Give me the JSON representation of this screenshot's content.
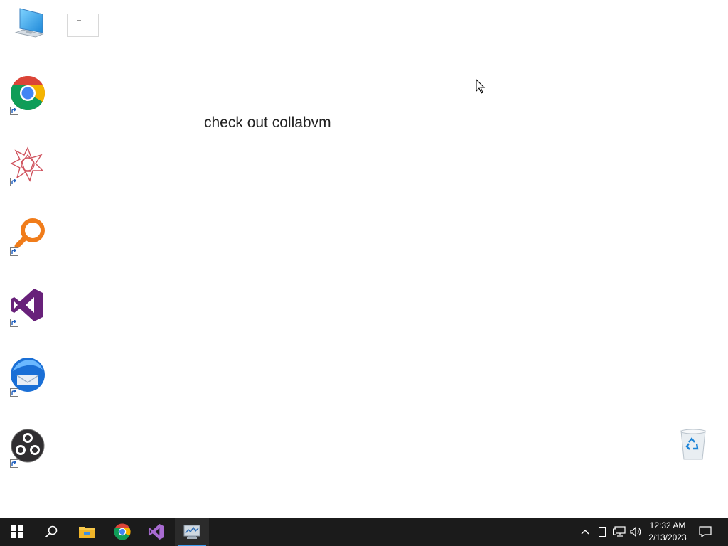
{
  "desktop": {
    "text": "check out collabvm",
    "icons": [
      {
        "name": "this-pc-icon"
      },
      {
        "name": "google-chrome-icon"
      },
      {
        "name": "wolfram-mathematica-icon"
      },
      {
        "name": "magnifier-search-app-icon"
      },
      {
        "name": "visual-studio-icon"
      },
      {
        "name": "thunderbird-icon"
      },
      {
        "name": "obs-studio-icon"
      },
      {
        "name": "recycle-bin-icon"
      }
    ]
  },
  "taskbar": {
    "buttons": [
      "start-icon",
      "search-icon",
      "file-explorer-icon",
      "google-chrome-icon",
      "visual-studio-icon",
      "performance-monitor-icon"
    ],
    "active_button": "performance-monitor-icon",
    "tray": [
      "show-hidden-icons-icon",
      "action-center-tablet-icon",
      "network-icon",
      "volume-icon",
      "notifications-icon"
    ],
    "time": "12:32 AM",
    "date": "2/13/2023"
  },
  "colors": {
    "taskbar_bg": "#1b1b1b",
    "accent": "#3c9cf0",
    "desktop_bg": "#ffffff"
  }
}
